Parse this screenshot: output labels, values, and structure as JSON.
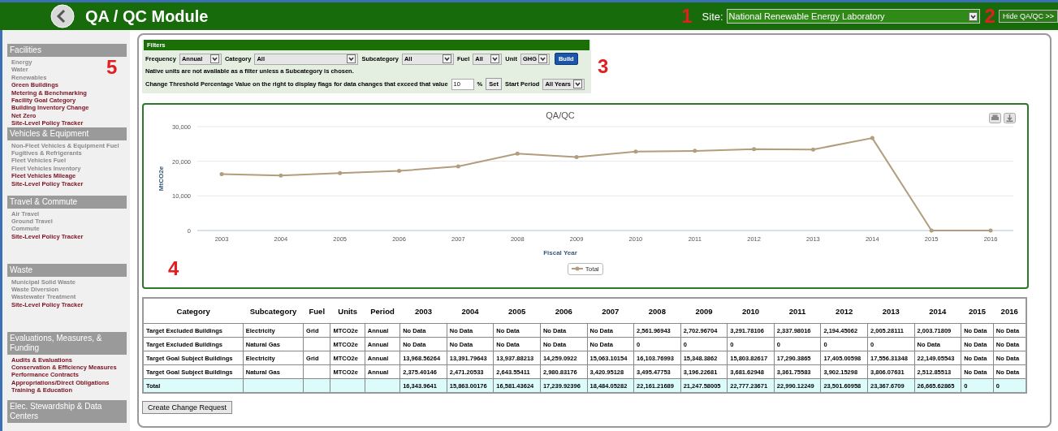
{
  "header": {
    "title": "QA / QC Module",
    "site_label": "Site:",
    "site_value": "National Renewable Energy Laboratory",
    "hide_button": "Hide QA/QC >>",
    "site_callout": "1",
    "hide_callout": "2"
  },
  "sidebar": {
    "callout": "5",
    "sections": [
      {
        "title": "Facilities",
        "items": [
          {
            "label": "Energy",
            "disabled": true
          },
          {
            "label": "Water",
            "disabled": true
          },
          {
            "label": "Renewables",
            "disabled": true
          },
          {
            "label": "Green Buildings",
            "disabled": false
          },
          {
            "label": "Metering & Benchmarking",
            "disabled": false
          },
          {
            "label": "Facility Goal Category",
            "disabled": false
          },
          {
            "label": "Building Inventory Change",
            "disabled": false
          },
          {
            "label": "Net Zero",
            "disabled": false
          },
          {
            "label": "Site-Level Policy Tracker",
            "disabled": false
          }
        ]
      },
      {
        "title": "Vehicles & Equipment",
        "items": [
          {
            "label": "Non-Fleet Vehicles & Equipment Fuel",
            "disabled": true
          },
          {
            "label": "Fugitives & Refrigerants",
            "disabled": true
          },
          {
            "label": "Fleet Vehicles Fuel",
            "disabled": true
          },
          {
            "label": "Fleet Vehicles Inventory",
            "disabled": true
          },
          {
            "label": "Fleet Vehicles Mileage",
            "disabled": false
          },
          {
            "label": "Site-Level Policy Tracker",
            "disabled": false
          }
        ]
      },
      {
        "title": "Travel & Commute",
        "items": [
          {
            "label": "Air Travel",
            "disabled": true
          },
          {
            "label": "Ground Travel",
            "disabled": true
          },
          {
            "label": "Commute",
            "disabled": true
          },
          {
            "label": "Site-Level Policy Tracker",
            "disabled": false
          }
        ]
      },
      {
        "title": "Waste",
        "items": [
          {
            "label": "Municipal Solid Waste",
            "disabled": true
          },
          {
            "label": "Waste Diversion",
            "disabled": true
          },
          {
            "label": "Wastewater Treatment",
            "disabled": true
          },
          {
            "label": "Site-Level Policy Tracker",
            "disabled": false
          }
        ]
      },
      {
        "title": "Evaluations, Measures, & Funding",
        "items": [
          {
            "label": "Audits & Evaluations",
            "disabled": false
          },
          {
            "label": "Conservation & Efficiency Measures",
            "disabled": false
          },
          {
            "label": "Performance Contracts",
            "disabled": false
          },
          {
            "label": "Appropriations/Direct Obligations",
            "disabled": false
          },
          {
            "label": "Training & Education",
            "disabled": false
          }
        ]
      },
      {
        "title": "Elec. Stewardship & Data Centers"
      }
    ]
  },
  "filters": {
    "title": "Filters",
    "callout": "3",
    "selects": [
      {
        "label": "Frequency",
        "value": "Annual"
      },
      {
        "label": "Category",
        "value": "All"
      },
      {
        "label": "Subcategory",
        "value": "All"
      },
      {
        "label": "Fuel",
        "value": "All"
      },
      {
        "label": "Unit",
        "value": "GHG"
      }
    ],
    "build_button": "Build",
    "note": "Native units are not available as a filter unless a Subcategory is chosen.",
    "threshold_label": "Change Threshold Percentage Value on the right to display flags for data changes that exceed that value",
    "threshold_value": "10",
    "percent": "%",
    "set_button": "Set",
    "start_label": "Start Period",
    "start_value": "All Years"
  },
  "chart_panel": {
    "callout": "4",
    "chart_data": {
      "type": "line",
      "title": "QA/QC",
      "xlabel": "Fiscal Year",
      "ylabel": "MtCO2e",
      "categories": [
        "2003",
        "2004",
        "2005",
        "2006",
        "2007",
        "2008",
        "2009",
        "2010",
        "2011",
        "2012",
        "2013",
        "2014",
        "2015",
        "2016"
      ],
      "series": [
        {
          "name": "Total",
          "color": "#b29d7d",
          "values": [
            16300,
            15900,
            16600,
            17200,
            18500,
            22200,
            21200,
            22800,
            23000,
            23500,
            23400,
            26700,
            0,
            0
          ]
        }
      ],
      "ylim": [
        0,
        30000
      ],
      "yticks": [
        {
          "value": 0,
          "label": "0"
        },
        {
          "value": 10000,
          "label": "10,000"
        },
        {
          "value": 20000,
          "label": "20,000"
        },
        {
          "value": 30000,
          "label": "30,000"
        }
      ]
    }
  },
  "table": {
    "columns": [
      "Category",
      "Subcategory",
      "Fuel",
      "Units",
      "Period",
      "2003",
      "2004",
      "2005",
      "2006",
      "2007",
      "2008",
      "2009",
      "2010",
      "2011",
      "2012",
      "2013",
      "2014",
      "2015",
      "2016"
    ],
    "rows": [
      {
        "total": false,
        "cells": [
          "Target Excluded Buildings",
          "Electricity",
          "Grid",
          "MTCO2e",
          "Annual",
          "No Data",
          "No Data",
          "No Data",
          "No Data",
          "No Data",
          "2,561.96943",
          "2,702.96704",
          "3,291.78106",
          "2,337.98016",
          "2,194.45062",
          "2,005.28111",
          "2,003.71809",
          "No Data",
          "No Data"
        ]
      },
      {
        "total": false,
        "cells": [
          "Target Excluded Buildings",
          "Natural Gas",
          "",
          "MTCO2e",
          "Annual",
          "No Data",
          "No Data",
          "No Data",
          "No Data",
          "No Data",
          "0",
          "0",
          "0",
          "0",
          "0",
          "0",
          "No Data",
          "No Data",
          "No Data"
        ]
      },
      {
        "total": false,
        "cells": [
          "Target Goal Subject Buildings",
          "Electricity",
          "Grid",
          "MTCO2e",
          "Annual",
          "13,968.56264",
          "13,391.79643",
          "13,937.88213",
          "14,259.0922",
          "15,063.10154",
          "16,103.76993",
          "15,348.3862",
          "15,803.82617",
          "17,290.3865",
          "17,405.00598",
          "17,556.31348",
          "22,149.05543",
          "No Data",
          "No Data"
        ]
      },
      {
        "total": false,
        "cells": [
          "Target Goal Subject Buildings",
          "Natural Gas",
          "",
          "MTCO2e",
          "Annual",
          "2,375.40146",
          "2,471.20533",
          "2,643.55411",
          "2,980.83176",
          "3,420.95128",
          "3,495.47753",
          "3,196.22681",
          "3,681.62948",
          "3,361.75583",
          "3,902.15298",
          "3,806.07631",
          "2,512.85513",
          "No Data",
          "No Data"
        ]
      },
      {
        "total": true,
        "cells": [
          "Total",
          "",
          "",
          "",
          "",
          "16,343.9641",
          "15,863.00176",
          "16,581.43624",
          "17,239.92396",
          "18,484.05282",
          "22,161.21689",
          "21,247.58005",
          "22,777.23671",
          "22,990.12249",
          "23,501.60958",
          "23,367.6709",
          "26,665.62865",
          "0",
          "0"
        ]
      }
    ]
  },
  "change_button": "Create Change Request"
}
